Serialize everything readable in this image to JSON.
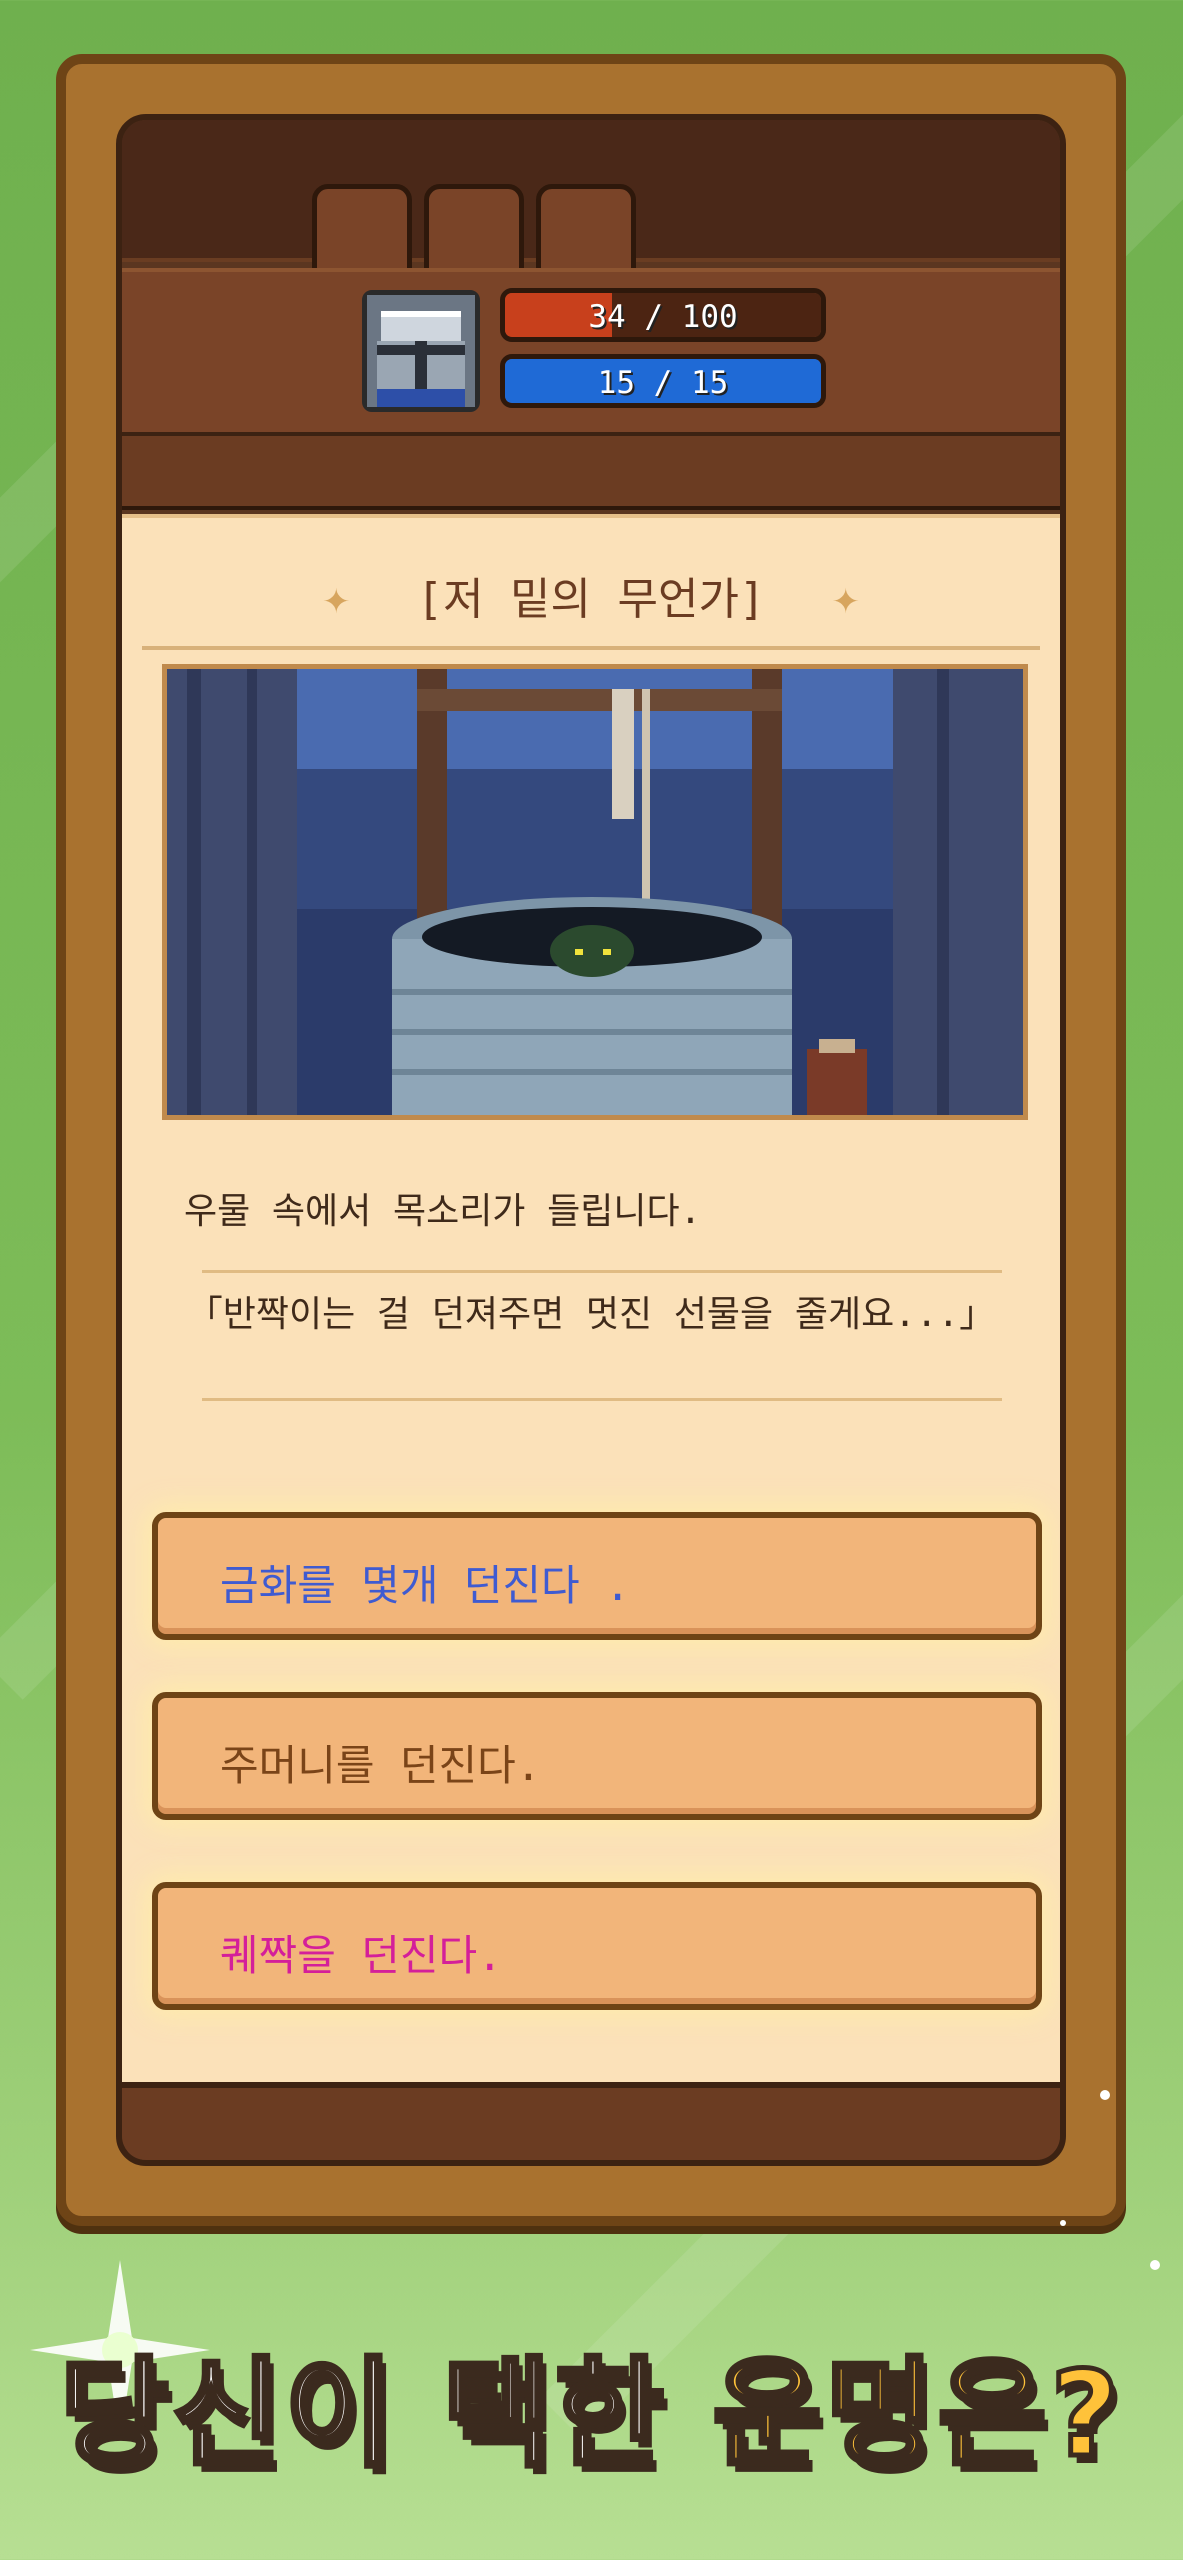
{
  "hud": {
    "hp_text": "34 / 100",
    "hp_fraction": 0.34,
    "mp_text": "15 / 15",
    "mp_fraction": 1.0,
    "hp_color": "#c8401c",
    "mp_color": "#1f6ad6",
    "empty_slots": [
      "",
      "",
      ""
    ],
    "avatar_icon": "knight-helmet-icon"
  },
  "event": {
    "title": "[저 밑의 무언가]",
    "title_ornament_icon": "sparkle-icon",
    "illustration": "well-at-night-illustration",
    "narration": "우물 속에서 목소리가 들립니다.",
    "quote": "「반짝이는 걸 던져주면 멋진 선물을 줄게요...」"
  },
  "choices": [
    {
      "label": "금화를 몇개 던진다 .",
      "color": "#3f5bd1"
    },
    {
      "label": "주머니를 던진다.",
      "color": "#7a4418"
    },
    {
      "label": "퀘짝을 던진다.",
      "color": "#d41f9a"
    }
  ],
  "promo": {
    "headline_white": "당신이 택한 ",
    "headline_yellow": "운명은?"
  }
}
